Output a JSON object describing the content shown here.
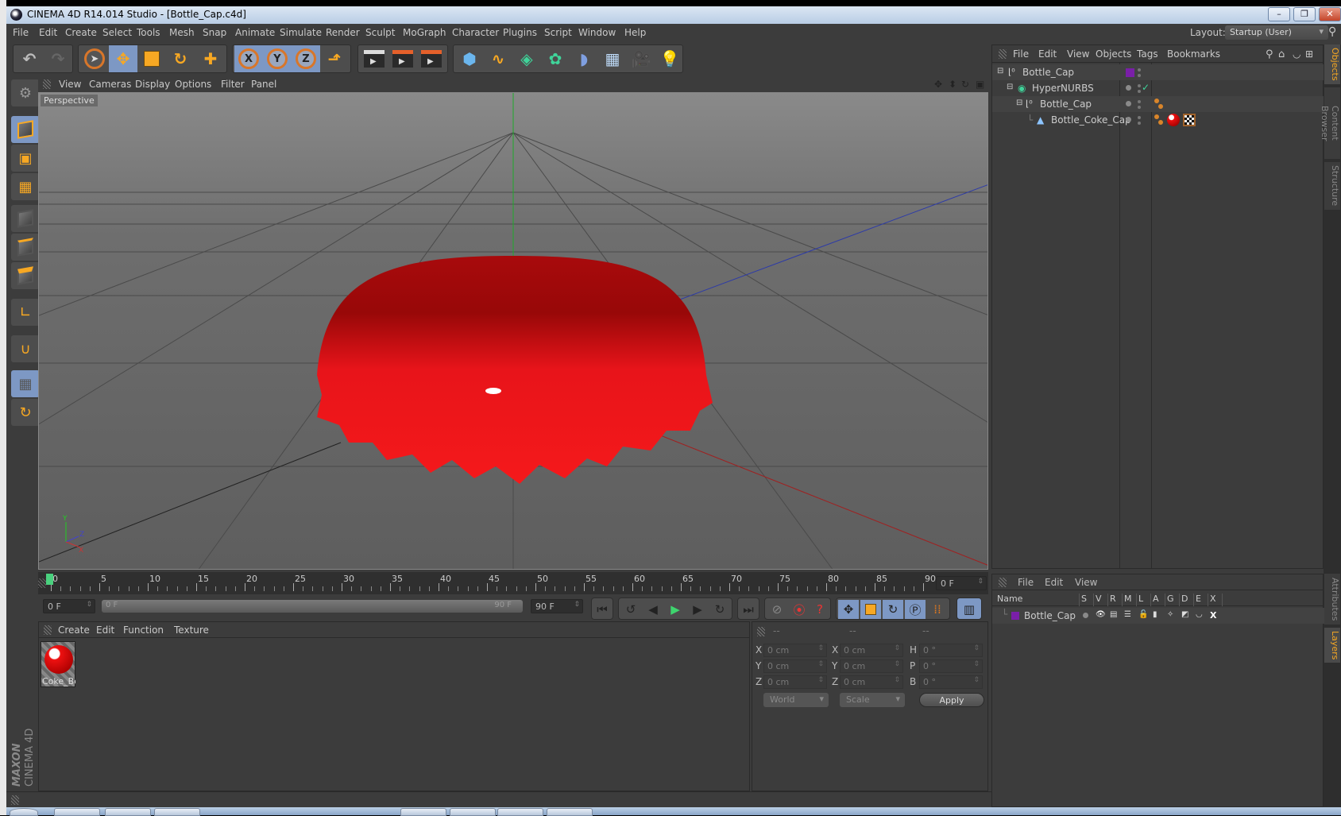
{
  "window": {
    "title": "CINEMA 4D R14.014 Studio - [Bottle_Cap.c4d]",
    "controls": {
      "minimize": "–",
      "restore": "❐",
      "close": "✕"
    }
  },
  "menubar": {
    "items": [
      "File",
      "Edit",
      "Create",
      "Select",
      "Tools",
      "Mesh",
      "Snap",
      "Animate",
      "Simulate",
      "Render",
      "Sculpt",
      "MoGraph",
      "Character",
      "Plugins",
      "Script",
      "Window",
      "Help"
    ],
    "layout_label": "Layout:",
    "layout_value": "Startup (User)"
  },
  "toolbar": {
    "icons": [
      "undo-icon",
      "redo-icon",
      "live-selection-icon",
      "move-icon",
      "scale-icon",
      "rotate-icon",
      "last-tool-icon",
      "x-axis-lock-icon",
      "y-axis-lock-icon",
      "z-axis-lock-icon",
      "coordinate-system-icon",
      "render-view-icon",
      "render-picture-viewer-icon",
      "render-settings-icon",
      "cube-primitive-icon",
      "spline-pen-icon",
      "nurbs-icon",
      "array-icon",
      "deformer-icon",
      "floor-scene-icon",
      "camera-icon",
      "light-icon"
    ],
    "axis_labels": [
      "X",
      "Y",
      "Z"
    ]
  },
  "left_tools": [
    "make-editable-icon",
    "model-mode-icon",
    "texture-mode-icon",
    "workplane-mode-icon",
    "points-mode-icon",
    "edges-mode-icon",
    "polygons-mode-icon",
    "axis-mode-icon",
    "snap-magnet-icon",
    "locked-workplane-icon",
    "workplane-rotate-icon"
  ],
  "branding": {
    "maxon": "MAXON",
    "product": "CINEMA 4D"
  },
  "viewport": {
    "menu": [
      "View",
      "Cameras",
      "Display",
      "Options",
      "Filter",
      "Panel"
    ],
    "camera_label": "Perspective",
    "nav_icons": [
      "pan-icon",
      "dolly-icon",
      "orbit-icon",
      "toggle-views-icon"
    ],
    "axis_gizmo": {
      "x": "X",
      "y": "Y",
      "z": "Z"
    }
  },
  "timeline": {
    "ticks": [
      0,
      5,
      10,
      15,
      20,
      25,
      30,
      35,
      40,
      45,
      50,
      55,
      60,
      65,
      70,
      75,
      80,
      85,
      90
    ],
    "current_frame_display": "0 F",
    "start_field": "0 F",
    "range_start": "0 F",
    "range_end": "90 F",
    "end_field": "90 F",
    "playhead_frame": 0
  },
  "playback": {
    "buttons": [
      "go-to-start-icon",
      "previous-key-icon",
      "previous-frame-icon",
      "play-icon",
      "next-frame-icon",
      "next-key-icon",
      "go-to-end-icon"
    ],
    "record_buttons": [
      "autokey-icon",
      "record-keys-icon",
      "keyframe-selection-icon"
    ],
    "key_buttons": [
      "key-position-icon",
      "key-scale-icon",
      "key-rotation-icon",
      "key-parameter-icon",
      "key-pla-icon"
    ],
    "timeline_toggle": "timeline-icon"
  },
  "material_manager": {
    "menu": [
      "Create",
      "Edit",
      "Function",
      "Texture"
    ],
    "materials": [
      {
        "name": "Coke_Bo"
      }
    ]
  },
  "coordinates": {
    "headers": [
      "--",
      "--",
      "--"
    ],
    "rows": [
      {
        "a_label": "X",
        "a": "0 cm",
        "b_label": "X",
        "b": "0 cm",
        "c_label": "H",
        "c": "0 °"
      },
      {
        "a_label": "Y",
        "a": "0 cm",
        "b_label": "Y",
        "b": "0 cm",
        "c_label": "P",
        "c": "0 °"
      },
      {
        "a_label": "Z",
        "a": "0 cm",
        "b_label": "Z",
        "b": "0 cm",
        "c_label": "B",
        "c": "0 °"
      }
    ],
    "space": "World",
    "mode": "Scale",
    "apply": "Apply"
  },
  "object_manager": {
    "menu": [
      "File",
      "Edit",
      "View",
      "Objects",
      "Tags",
      "Bookmarks"
    ],
    "objects": [
      {
        "name": "Bottle_Cap",
        "type": "null",
        "depth": 0
      },
      {
        "name": "HyperNURBS",
        "type": "hypernurbs",
        "depth": 1
      },
      {
        "name": "Bottle_Cap",
        "type": "null",
        "depth": 2
      },
      {
        "name": "Bottle_Coke_Cap",
        "type": "polygon",
        "depth": 3
      }
    ]
  },
  "layer_manager": {
    "menu": [
      "File",
      "Edit",
      "View"
    ],
    "columns": [
      "Name",
      "S",
      "V",
      "R",
      "M",
      "L",
      "A",
      "G",
      "D",
      "E",
      "X"
    ],
    "layers": [
      {
        "name": "Bottle_Cap",
        "color": "#7a1fa8"
      }
    ]
  },
  "side_tabs": {
    "top": [
      "Objects",
      "Content Browser",
      "Structure"
    ],
    "bottom": [
      "Attributes",
      "Layers"
    ]
  },
  "colors": {
    "accent": "#f7a823",
    "selected_tool": "#7d98c4",
    "playhead": "#4ad17e",
    "layer": "#7a1fa8",
    "object_red": "#e8141a"
  }
}
